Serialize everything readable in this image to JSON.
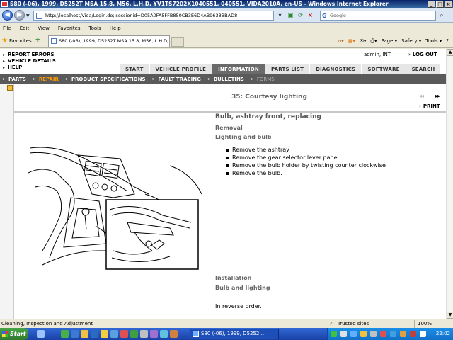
{
  "window": {
    "title": "S80 (-06), 1999, D5252T MSA 15.8, M56, L.H.D, YV1TS7202X1040551, 040551, VIDA2010A, en-US - Windows Internet Explorer",
    "buttons": {
      "minimize": "_",
      "maximize": "□",
      "close": "×"
    }
  },
  "addressbar": {
    "url": "http://localhost/Vida/Login.do;jsessionid=D05A0FA5FFB850CB3E6D4AB9633BBAD8",
    "search_placeholder": "Google",
    "search_engine_glyph": "G"
  },
  "menubar": {
    "items": [
      "File",
      "Edit",
      "View",
      "Favorites",
      "Tools",
      "Help"
    ]
  },
  "favbar": {
    "favorites_label": "Favorites",
    "tab_title": "S80 (-06), 1999, D5252T MSA 15.8, M56, L.H.D, YV1...",
    "commands": [
      "Page ▾",
      "Safety ▾",
      "Tools ▾",
      "?"
    ]
  },
  "page": {
    "toplinks": [
      "REPORT ERRORS",
      "VEHICLE DETAILS",
      "HELP"
    ],
    "user": "admin, INT",
    "logout": "LOG OUT",
    "tabs": [
      {
        "label": "START",
        "active": false
      },
      {
        "label": "VEHICLE PROFILE",
        "active": false
      },
      {
        "label": "INFORMATION",
        "active": true
      },
      {
        "label": "PARTS LIST",
        "active": false
      },
      {
        "label": "DIAGNOSTICS",
        "active": false
      },
      {
        "label": "SOFTWARE",
        "active": false
      },
      {
        "label": "SEARCH",
        "active": false
      }
    ],
    "subnav": [
      {
        "label": "PARTS",
        "state": "normal"
      },
      {
        "label": "REPAIR",
        "state": "active"
      },
      {
        "label": "PRODUCT SPECIFICATIONS",
        "state": "normal"
      },
      {
        "label": "FAULT TRACING",
        "state": "normal"
      },
      {
        "label": "BULLETINS",
        "state": "normal"
      },
      {
        "label": "FORMS",
        "state": "disabled"
      }
    ],
    "doc": {
      "heading": "35: Courtesy lighting",
      "nav_prev": "◂◂",
      "nav_next": "▸▸",
      "print": "PRINT",
      "title": "Bulb, ashtray front, replacing",
      "section_removal": "Removal",
      "sub_removal": "Lighting and bulb",
      "steps": [
        "Remove the ashtray",
        "Remove the gear selector lever panel",
        "Remove the bulb holder by twisting counter clockwise",
        "Remove the bulb."
      ],
      "section_installation": "Installation",
      "sub_installation": "Bulb and lighting",
      "install_text": "In reverse order."
    }
  },
  "statusbar": {
    "message": "Cleaning, Inspection and Adjustment",
    "zone": "Trusted sites",
    "zoom": "100%"
  },
  "taskbar": {
    "start": "Start",
    "task": "S80 (-06), 1999, D5252...",
    "clock": "22:02"
  },
  "colors": {
    "accent": "#ff9900",
    "nav_dark": "#5a5a5a",
    "tab_active": "#6a6a6a"
  }
}
